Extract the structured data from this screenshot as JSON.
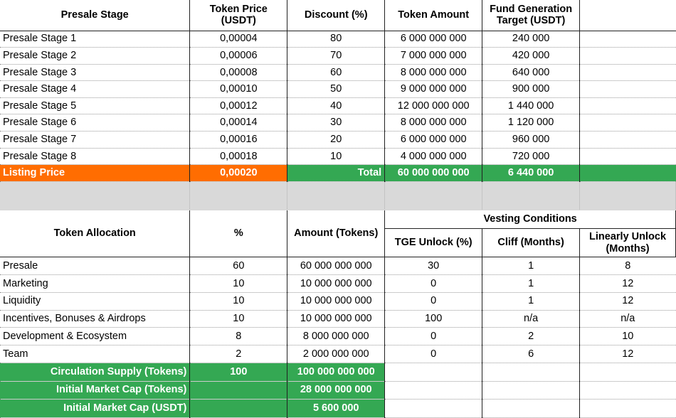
{
  "presale": {
    "headers": {
      "stage": "Presale Stage",
      "price": "Token Price (USDT)",
      "discount": "Discount (%)",
      "amount": "Token Amount",
      "target": "Fund Generation Target (USDT)"
    },
    "rows": [
      {
        "stage": "Presale Stage 1",
        "price": "0,00004",
        "discount": "80",
        "amount": "6 000 000 000",
        "target": "240 000"
      },
      {
        "stage": "Presale Stage 2",
        "price": "0,00006",
        "discount": "70",
        "amount": "7 000 000 000",
        "target": "420 000"
      },
      {
        "stage": "Presale Stage 3",
        "price": "0,00008",
        "discount": "60",
        "amount": "8 000 000 000",
        "target": "640 000"
      },
      {
        "stage": "Presale Stage 4",
        "price": "0,00010",
        "discount": "50",
        "amount": "9 000 000 000",
        "target": "900 000"
      },
      {
        "stage": "Presale Stage 5",
        "price": "0,00012",
        "discount": "40",
        "amount": "12 000 000 000",
        "target": "1 440 000"
      },
      {
        "stage": "Presale Stage 6",
        "price": "0,00014",
        "discount": "30",
        "amount": "8 000 000 000",
        "target": "1 120 000"
      },
      {
        "stage": "Presale Stage 7",
        "price": "0,00016",
        "discount": "20",
        "amount": "6 000 000 000",
        "target": "960 000"
      },
      {
        "stage": "Presale Stage 8",
        "price": "0,00018",
        "discount": "10",
        "amount": "4 000 000 000",
        "target": "720 000"
      }
    ],
    "listing": {
      "label": "Listing Price",
      "price": "0,00020",
      "total_label": "Total",
      "total_amount": "60 000 000 000",
      "total_target": "6 440 000"
    }
  },
  "allocation": {
    "headers": {
      "allocation": "Token Allocation",
      "percent": "%",
      "amount": "Amount (Tokens)",
      "vesting": "Vesting Conditions",
      "tge": "TGE Unlock (%)",
      "cliff": "Cliff (Months)",
      "linear": "Linearly Unlock (Months)"
    },
    "rows": [
      {
        "name": "Presale",
        "percent": "60",
        "amount": "60 000 000 000",
        "tge": "30",
        "cliff": "1",
        "linear": "8"
      },
      {
        "name": "Marketing",
        "percent": "10",
        "amount": "10 000 000 000",
        "tge": "0",
        "cliff": "1",
        "linear": "12"
      },
      {
        "name": "Liquidity",
        "percent": "10",
        "amount": "10 000 000 000",
        "tge": "0",
        "cliff": "1",
        "linear": "12"
      },
      {
        "name": "Incentives, Bonuses & Airdrops",
        "percent": "10",
        "amount": "10 000 000 000",
        "tge": "100",
        "cliff": "n/a",
        "linear": "n/a"
      },
      {
        "name": "Development & Ecosystem",
        "percent": "8",
        "amount": "8 000 000 000",
        "tge": "0",
        "cliff": "2",
        "linear": "10"
      },
      {
        "name": "Team",
        "percent": "2",
        "amount": "2 000 000 000",
        "tge": "0",
        "cliff": "6",
        "linear": "12"
      }
    ],
    "summary": [
      {
        "label": "Circulation Supply (Tokens)",
        "percent": "100",
        "value": "100 000 000 000"
      },
      {
        "label": "Initial Market Cap (Tokens)",
        "percent": "",
        "value": "28 000 000 000"
      },
      {
        "label": "Initial Market Cap (USDT)",
        "percent": "",
        "value": "5 600 000"
      }
    ]
  },
  "colors": {
    "orange": "#ff6d01",
    "green": "#34a853",
    "gray": "#d9d9d9"
  }
}
